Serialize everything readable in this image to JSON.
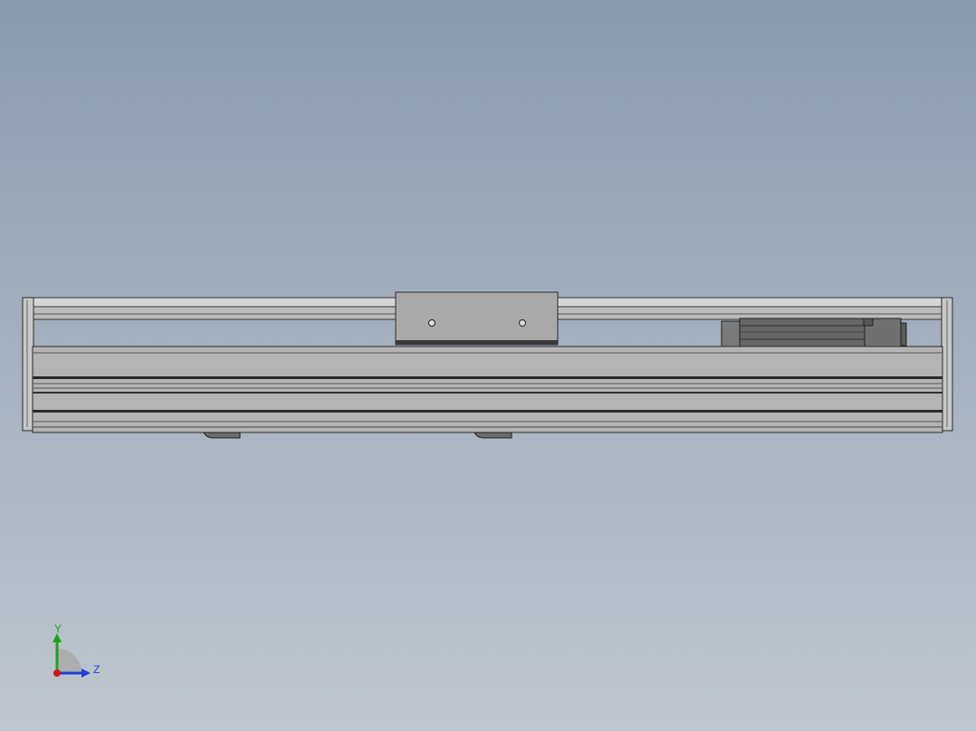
{
  "viewport": {
    "background_top": "#8b9bae",
    "background_bottom": "#bfc6cf",
    "model": "linear-actuator-side-view"
  },
  "triad": {
    "y_label": "Y",
    "z_label": "Z",
    "y_color": "#1aa31a",
    "z_color": "#1f3fd6",
    "x_color": "#d01818"
  },
  "colors": {
    "profile_fill": "#b4b4b4",
    "profile_edge": "#2a2a2a",
    "carriage_fill": "#a9a9a9",
    "motor_fill": "#6e6e6e"
  }
}
